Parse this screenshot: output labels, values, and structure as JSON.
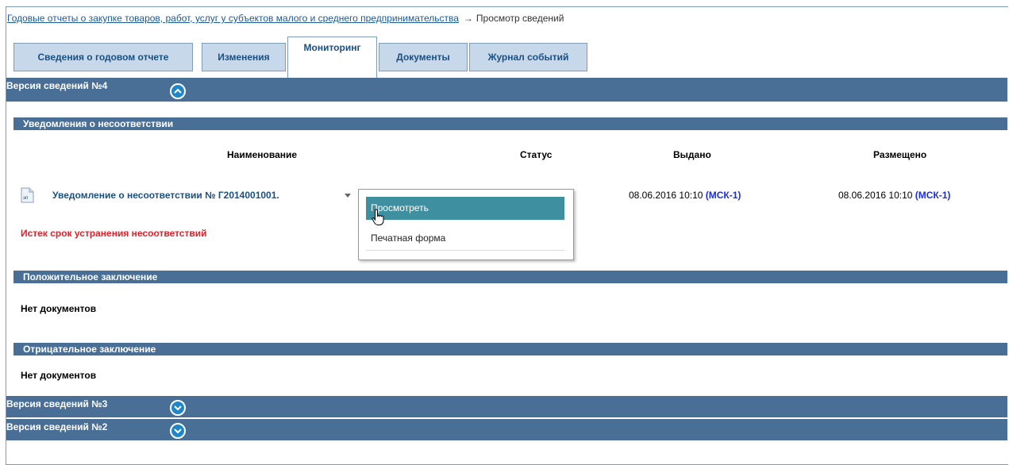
{
  "breadcrumb": {
    "link": "Годовые отчеты о закупке товаров, работ, услуг у субъектов малого и среднего предпринимательства",
    "arrow": "→",
    "current": "Просмотр сведений"
  },
  "tabs": [
    {
      "label": "Сведения о годовом отчете",
      "active": false
    },
    {
      "label": "Изменения",
      "active": false
    },
    {
      "label": "Мониторинг",
      "active": true
    },
    {
      "label": "Документы",
      "active": false
    },
    {
      "label": "Журнал событий",
      "active": false
    }
  ],
  "versions": {
    "v4": "Версия сведений №4",
    "v3": "Версия сведений №3",
    "v2": "Версия сведений №2"
  },
  "sections": {
    "notices": "Уведомления о несоответствии",
    "positive": "Положительное заключение",
    "negative": "Отрицательное заключение"
  },
  "table": {
    "columns": [
      "Наименование",
      "Статус",
      "Выдано",
      "Размещено"
    ],
    "row": {
      "icon": "document-icon",
      "icon_text": "эп",
      "name": "Уведомление о несоответствии № Г2014001001.",
      "issued_date": "08.06.2016 10:10",
      "issued_tz": "(МСК-1)",
      "published_date": "08.06.2016 10:10",
      "published_tz": "(МСК-1)",
      "warning": "Истек срок устранения несоответствий"
    }
  },
  "context_menu": {
    "items": [
      "Просмотреть",
      "Печатная форма"
    ]
  },
  "no_documents": "Нет документов",
  "colors": {
    "bar": "#4a6f97",
    "tab": "#c6d8ea",
    "link": "#1a4f82",
    "warning": "#e0202a",
    "menu_highlight": "#3e8fa0"
  }
}
